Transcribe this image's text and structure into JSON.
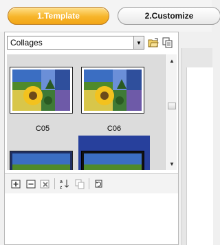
{
  "steps": [
    {
      "label": "1.Template",
      "active": true
    },
    {
      "label": "2.Customize",
      "active": false
    }
  ],
  "template_selector": {
    "value": "Collages",
    "buttons": [
      "open-folder-icon",
      "copy-icon"
    ]
  },
  "gallery": {
    "items": [
      {
        "label": "C05",
        "selected": false
      },
      {
        "label": "C06",
        "selected": false
      },
      {
        "label": "",
        "selected": false
      },
      {
        "label": "",
        "selected": true
      }
    ]
  },
  "toolbar": {
    "icons": [
      "add-icon",
      "remove-icon",
      "delete-icon",
      "sort-az-icon",
      "copy-icon",
      "refresh-icon"
    ]
  },
  "colors": {
    "accent": "#f7b52a",
    "selection": "#27409c",
    "sky": "#3b6ec2",
    "grass": "#4f8a2a"
  }
}
